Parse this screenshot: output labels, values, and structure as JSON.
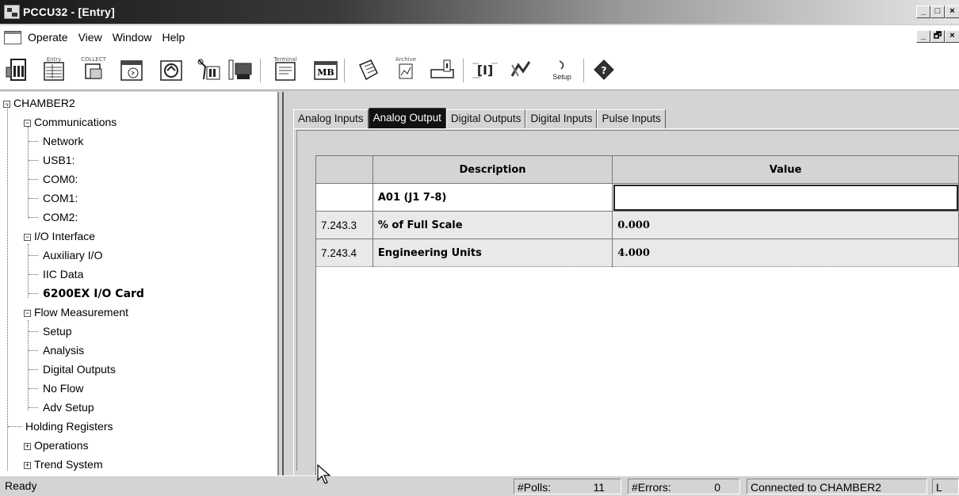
{
  "window": {
    "title": "PCCU32 - [Entry]",
    "minimize": "_",
    "maximize": "□",
    "close": "×",
    "mdi_minimize": "_",
    "mdi_restore": "🗗",
    "mdi_close": "×"
  },
  "menu": {
    "items": [
      "Operate",
      "View",
      "Window",
      "Help"
    ]
  },
  "toolbar": {
    "labels": {
      "entry": "Entry",
      "collect": "COLLECT",
      "terminal": "Terminal",
      "archive": "Archive",
      "setup": "Setup",
      "mb": "MB"
    },
    "buttons": [
      "meter-icon",
      "entry-icon",
      "collect-icon",
      "calendar-icon",
      "refresh-icon",
      "tools-icon",
      "loop-icon",
      "terminal-icon",
      "modbus-icon",
      "notes-icon",
      "archive-icon",
      "save-icon",
      "registers-icon",
      "trend-icon",
      "setup-icon",
      "help-icon"
    ]
  },
  "tree": {
    "root": "CHAMBER2",
    "items": [
      {
        "label": "Communications",
        "level": 1,
        "expander": "-"
      },
      {
        "label": "Network",
        "level": 2
      },
      {
        "label": "USB1:",
        "level": 2
      },
      {
        "label": "COM0:",
        "level": 2
      },
      {
        "label": "COM1:",
        "level": 2
      },
      {
        "label": "COM2:",
        "level": 2
      },
      {
        "label": "I/O Interface",
        "level": 1,
        "expander": "-"
      },
      {
        "label": "Auxiliary I/O",
        "level": 2
      },
      {
        "label": "IIC Data",
        "level": 2
      },
      {
        "label": "6200EX I/O Card",
        "level": 2,
        "selected": true
      },
      {
        "label": "Flow Measurement",
        "level": 1,
        "expander": "-"
      },
      {
        "label": "Setup",
        "level": 2
      },
      {
        "label": "Analysis",
        "level": 2
      },
      {
        "label": "Digital Outputs",
        "level": 2
      },
      {
        "label": "No Flow",
        "level": 2
      },
      {
        "label": "Adv Setup",
        "level": 2
      },
      {
        "label": "Holding Registers",
        "level": 1
      },
      {
        "label": "Operations",
        "level": 1,
        "expander": "+"
      },
      {
        "label": "Trend System",
        "level": 1,
        "expander": "+"
      }
    ]
  },
  "tabs": [
    {
      "label": "Analog Inputs",
      "active": false
    },
    {
      "label": "Analog Output",
      "active": true
    },
    {
      "label": "Digital Outputs",
      "active": false
    },
    {
      "label": "Digital Inputs",
      "active": false
    },
    {
      "label": "Pulse Inputs",
      "active": false
    }
  ],
  "grid": {
    "headers": {
      "index": "",
      "description": "Description",
      "value": "Value"
    },
    "rows": [
      {
        "index": "",
        "description": "A01 (J1 7-8)",
        "value": ""
      },
      {
        "index": "7.243.3",
        "description": "% of Full Scale",
        "value": "0.000"
      },
      {
        "index": "7.243.4",
        "description": "Engineering Units",
        "value": "4.000"
      }
    ]
  },
  "status": {
    "ready": "Ready",
    "polls_label": "#Polls:",
    "polls_value": "11",
    "errors_label": "#Errors:",
    "errors_value": "0",
    "connection": "Connected to CHAMBER2",
    "mode": "L"
  }
}
